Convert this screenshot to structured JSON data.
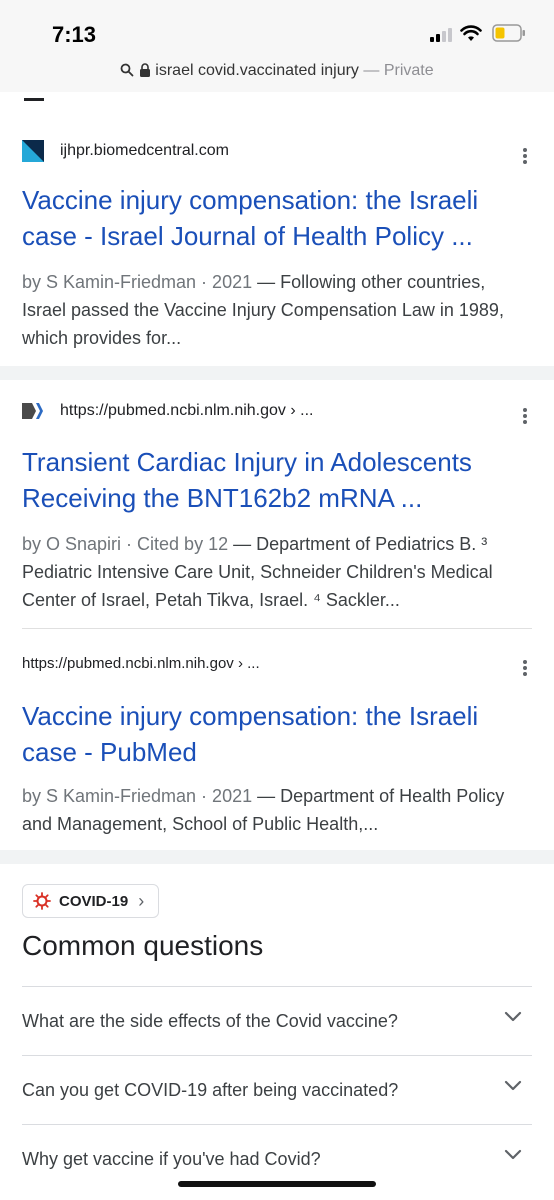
{
  "status_bar": {
    "time": "7:13"
  },
  "address_bar": {
    "query": "israel covid.vaccinated injury",
    "separator": " — ",
    "mode": "Private"
  },
  "results": [
    {
      "source": "ijhpr.biomedcentral.com",
      "title": "Vaccine injury compensation: the Israeli case - Israel Journal of Health Policy ...",
      "meta": "by S Kamin-Friedman · 2021",
      "snippet": " — Following other countries, Israel passed the Vaccine Injury Compensation Law in 1989, which provides for..."
    },
    {
      "source": "https://pubmed.ncbi.nlm.nih.gov › ...",
      "title": "Transient Cardiac Injury in Adolescents Receiving the BNT162b2 mRNA ...",
      "meta": "by O Snapiri · Cited by 12",
      "snippet": " — Department of Pediatrics B. ³ Pediatric Intensive Care Unit, Schneider Children's Medical Center of Israel, Petah Tikva, Israel. ⁴ Sackler..."
    },
    {
      "source": "https://pubmed.ncbi.nlm.nih.gov › ...",
      "title": "Vaccine injury compensation: the Israeli case - PubMed",
      "meta": "by S Kamin-Friedman · 2021",
      "snippet": " — Department of Health Policy and Management, School of Public Health,..."
    }
  ],
  "covid_chip": {
    "label": "COVID-19",
    "chevron": "›"
  },
  "common_questions": {
    "title": "Common questions",
    "items": [
      "What are the side effects of the Covid vaccine?",
      "Can you get COVID-19 after being vaccinated?",
      "Why get vaccine if you've had Covid?"
    ]
  },
  "colors": {
    "link": "#1a4fb8",
    "battery": "#f5c400",
    "virus": "#d93025"
  }
}
